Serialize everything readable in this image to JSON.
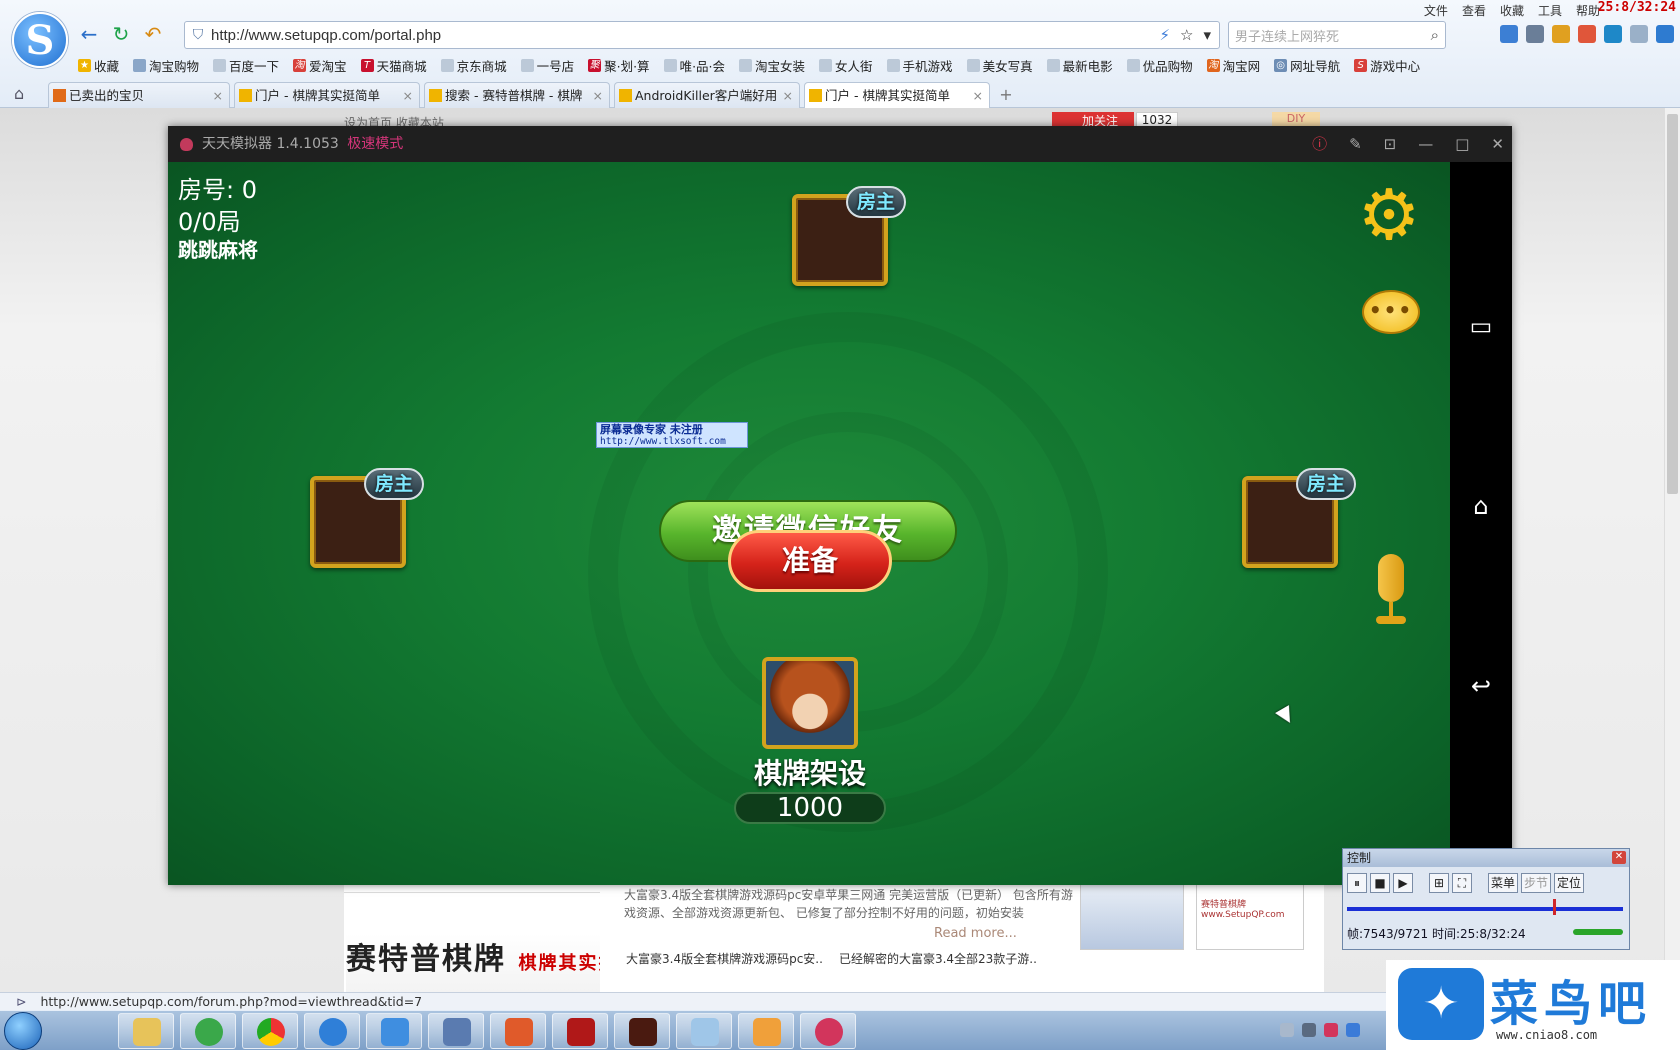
{
  "browser": {
    "url": "http://www.setupqp.com/portal.php",
    "search_placeholder": "男子连续上网猝死",
    "menu": [
      "文件",
      "查看",
      "收藏",
      "工具",
      "帮助"
    ],
    "clock": "25:8/32:24",
    "bookmarks": [
      "收藏",
      "淘宝购物",
      "百度一下",
      "爱淘宝",
      "天猫商城",
      "京东商城",
      "一号店",
      "聚·划·算",
      "唯·品·会",
      "淘宝女装",
      "女人街",
      "手机游戏",
      "美女写真",
      "最新电影",
      "优品购物",
      "淘宝网",
      "网址导航",
      "游戏中心"
    ],
    "tabs": [
      "已卖出的宝贝",
      "门户 - 棋牌其实挺简单",
      "搜索 - 赛特普棋牌 - 棋牌",
      "AndroidKiller客户端好用",
      "门户 - 棋牌其实挺简单"
    ],
    "status_url": "http://www.setupqp.com/forum.php?mod=viewthread&tid=7"
  },
  "page": {
    "top_links": "设为首页  收藏本站",
    "follow": "加关注",
    "follow_count": "1032",
    "diy": "DIY",
    "calligraphy": "赛特普棋牌",
    "calligraphy_red": "棋牌其实挺简单",
    "desc": "大富豪3.4版全套棋牌游戏源码pc安卓苹果三网通 完美运营版（已更新） 包含所有游戏资源、全部游戏资源更新包、 已修复了部分控制不好用的问题，初始安装",
    "read_more": "Read more...",
    "links": [
      "大富豪3.4版全套棋牌游戏源码pc安..",
      "已经解密的大富豪3.4全部23款子游.."
    ],
    "thumb2_text": "赛特普棋牌 www.SetupQP.com"
  },
  "emulator": {
    "title": "天天模拟器 1.4.1053",
    "mode": "极速模式"
  },
  "game": {
    "room": "房号: 0",
    "rounds": "0/0局",
    "game_name": "跳跳麻将",
    "host_badge": "房主",
    "invite_label": "邀请微信好友",
    "ready_label": "准备",
    "player_name": "棋牌架设",
    "score": "1000",
    "chat_dots": "•••"
  },
  "watermark": {
    "line1": "屏幕录像专家     未注册",
    "line2": "http://www.tlxsoft.com"
  },
  "recorder": {
    "title": "控制",
    "menu": "菜单",
    "step": "步节",
    "locate": "定位",
    "info": "帧:7543/9721 时间:25:8/32:24"
  },
  "brand": {
    "cn": "菜鸟吧",
    "en": "www.cniao8.com"
  },
  "colors": {
    "felt": "#137b32",
    "accent_red": "#d5231a",
    "accent_green": "#58b52c",
    "gold": "#d2a31e"
  }
}
